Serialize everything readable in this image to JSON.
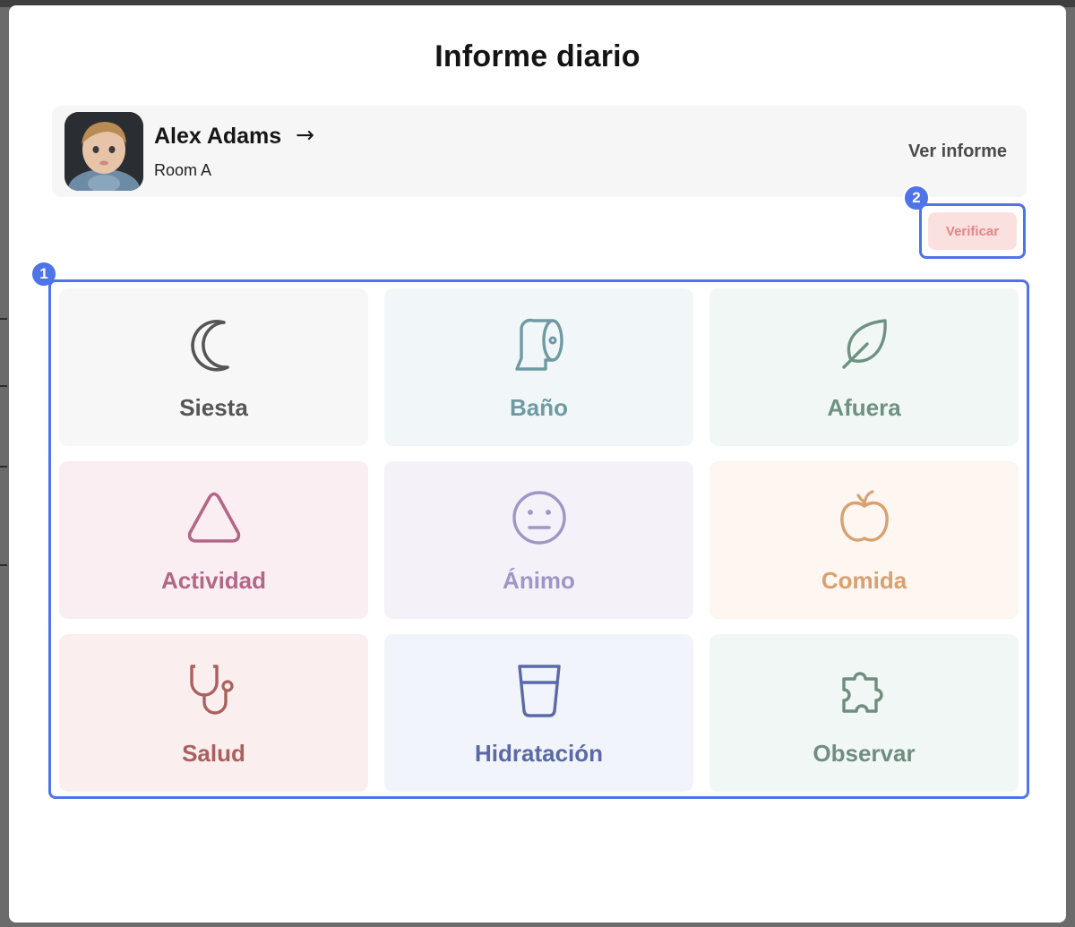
{
  "modal": {
    "title": "Informe diario"
  },
  "child": {
    "name": "Alex Adams",
    "arrow": "→",
    "room": "Room A",
    "view_report_label": "Ver informe"
  },
  "verify": {
    "label": "Verificar",
    "badge": "2"
  },
  "grid": {
    "badge": "1"
  },
  "categories": [
    {
      "label": "Siesta",
      "icon": "moon-icon",
      "bg": "#f7f7f7",
      "color": "#555555"
    },
    {
      "label": "Baño",
      "icon": "toilet-paper-icon",
      "bg": "#f1f7f8",
      "color": "#6f9aa3"
    },
    {
      "label": "Afuera",
      "icon": "leaf-icon",
      "bg": "#f1f7f5",
      "color": "#6f9182"
    },
    {
      "label": "Actividad",
      "icon": "triangle-icon",
      "bg": "#faeef3",
      "color": "#b26785"
    },
    {
      "label": "Ánimo",
      "icon": "neutral-face-icon",
      "bg": "#f5f1f8",
      "color": "#a096c6"
    },
    {
      "label": "Comida",
      "icon": "apple-icon",
      "bg": "#fdf6f1",
      "color": "#d9a070"
    },
    {
      "label": "Salud",
      "icon": "stethoscope-icon",
      "bg": "#faeeee",
      "color": "#a9605e"
    },
    {
      "label": "Hidratación",
      "icon": "glass-icon",
      "bg": "#f1f4fa",
      "color": "#5a6aa8"
    },
    {
      "label": "Observar",
      "icon": "puzzle-icon",
      "bg": "#f1f7f4",
      "color": "#6f8e80"
    }
  ]
}
